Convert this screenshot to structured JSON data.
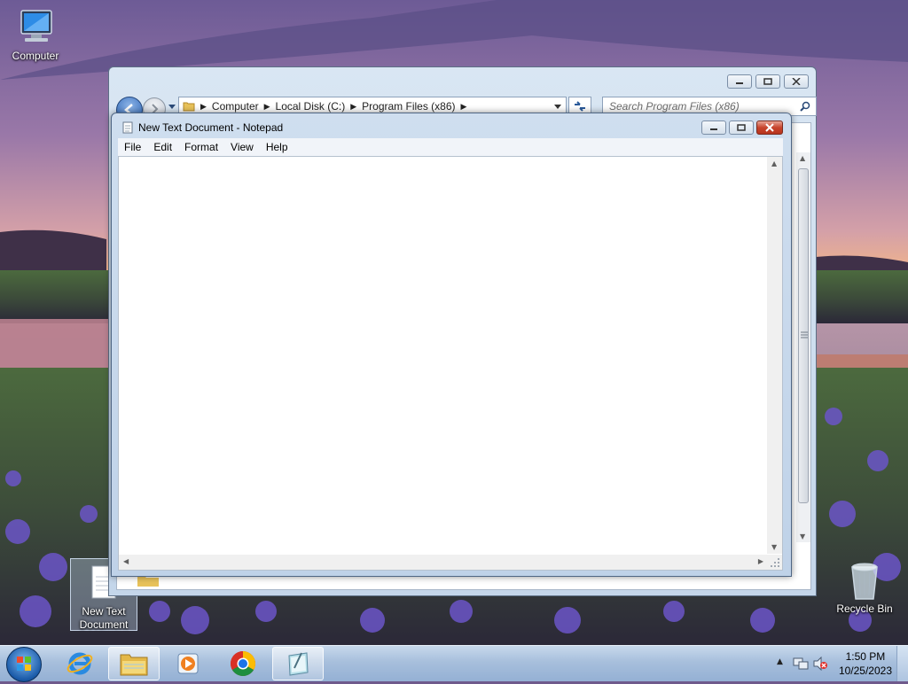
{
  "desktop": {
    "icons": [
      {
        "label": "Computer"
      },
      {
        "label": "New Text Document"
      },
      {
        "label": "Recycle Bin"
      }
    ]
  },
  "explorer": {
    "breadcrumb": [
      "Computer",
      "Local Disk (C:)",
      "Program Files (x86)"
    ],
    "search_placeholder": "Search Program Files (x86)"
  },
  "notepad": {
    "title": "New Text Document - Notepad",
    "menu": [
      "File",
      "Edit",
      "Format",
      "View",
      "Help"
    ],
    "content": ""
  },
  "taskbar": {
    "apps": [
      {
        "icon": "internet-explorer-icon",
        "active": false
      },
      {
        "icon": "file-explorer-icon",
        "active": true
      },
      {
        "icon": "media-player-icon",
        "active": false
      },
      {
        "icon": "chrome-icon",
        "active": false
      },
      {
        "icon": "notepad-icon",
        "active": true
      }
    ],
    "clock": {
      "time": "1:50 PM",
      "date": "10/25/2023"
    }
  },
  "colors": {
    "close_button": "#c7442c",
    "titlebar": "#cfdeef",
    "taskbar": "#a7bfdc"
  }
}
